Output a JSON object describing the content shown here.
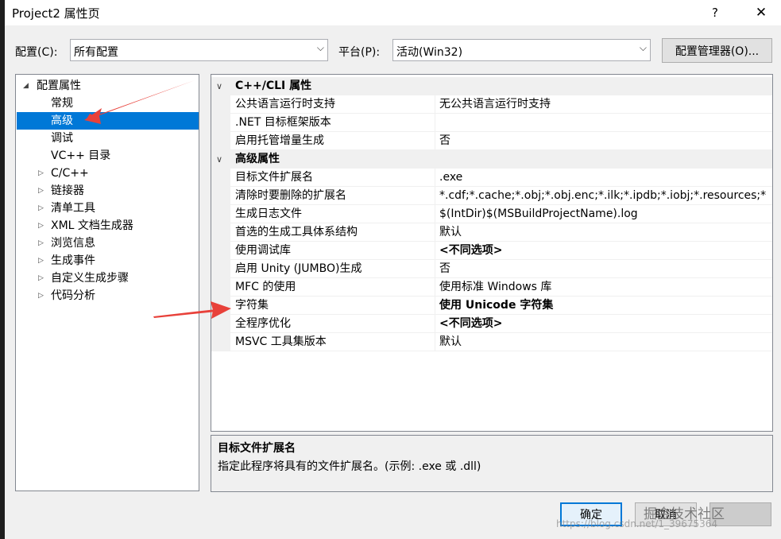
{
  "window": {
    "title": "Project2 属性页",
    "help": "?",
    "close": "✕"
  },
  "toolbar": {
    "config_label": "配置(C):",
    "config_value": "所有配置",
    "platform_label": "平台(P):",
    "platform_value": "活动(Win32)",
    "config_manager": "配置管理器(O)..."
  },
  "tree": {
    "items": [
      {
        "label": "配置属性",
        "twisty": "◢"
      },
      {
        "label": "常规",
        "twisty": ""
      },
      {
        "label": "高级",
        "twisty": ""
      },
      {
        "label": "调试",
        "twisty": ""
      },
      {
        "label": "VC++ 目录",
        "twisty": ""
      },
      {
        "label": "C/C++",
        "twisty": "▷"
      },
      {
        "label": "链接器",
        "twisty": "▷"
      },
      {
        "label": "清单工具",
        "twisty": "▷"
      },
      {
        "label": "XML 文档生成器",
        "twisty": "▷"
      },
      {
        "label": "浏览信息",
        "twisty": "▷"
      },
      {
        "label": "生成事件",
        "twisty": "▷"
      },
      {
        "label": "自定义生成步骤",
        "twisty": "▷"
      },
      {
        "label": "代码分析",
        "twisty": "▷"
      }
    ],
    "selected": "高级"
  },
  "grid": {
    "chevron": "∨",
    "categories": [
      {
        "name": "C++/CLI 属性",
        "rows": [
          {
            "name": "公共语言运行时支持",
            "value": "无公共语言运行时支持",
            "bold": false
          },
          {
            "name": ".NET 目标框架版本",
            "value": "",
            "bold": false
          },
          {
            "name": "启用托管增量生成",
            "value": "否",
            "bold": false
          }
        ]
      },
      {
        "name": "高级属性",
        "rows": [
          {
            "name": "目标文件扩展名",
            "value": ".exe",
            "bold": false
          },
          {
            "name": "清除时要删除的扩展名",
            "value": "*.cdf;*.cache;*.obj;*.obj.enc;*.ilk;*.ipdb;*.iobj;*.resources;*",
            "bold": false
          },
          {
            "name": "生成日志文件",
            "value": "$(IntDir)$(MSBuildProjectName).log",
            "bold": false
          },
          {
            "name": "首选的生成工具体系结构",
            "value": "默认",
            "bold": false
          },
          {
            "name": "使用调试库",
            "value": "<不同选项>",
            "bold": true
          },
          {
            "name": "启用 Unity (JUMBO)生成",
            "value": "否",
            "bold": false
          },
          {
            "name": "MFC 的使用",
            "value": "使用标准 Windows 库",
            "bold": false
          },
          {
            "name": "字符集",
            "value": "使用 Unicode 字符集",
            "bold": true
          },
          {
            "name": "全程序优化",
            "value": "<不同选项>",
            "bold": true
          },
          {
            "name": "MSVC 工具集版本",
            "value": "默认",
            "bold": false
          }
        ]
      }
    ]
  },
  "description": {
    "title": "目标文件扩展名",
    "text": "指定此程序将具有的文件扩展名。(示例: .exe 或 .dll)"
  },
  "buttons": {
    "ok": "确定",
    "cancel": "取消"
  },
  "watermark": {
    "text": "掘金技术社区",
    "url": "https://blog.csdn.net/1_39675364"
  },
  "colors": {
    "selection": "#0078d7",
    "annotation_arrow": "#e8413a"
  }
}
